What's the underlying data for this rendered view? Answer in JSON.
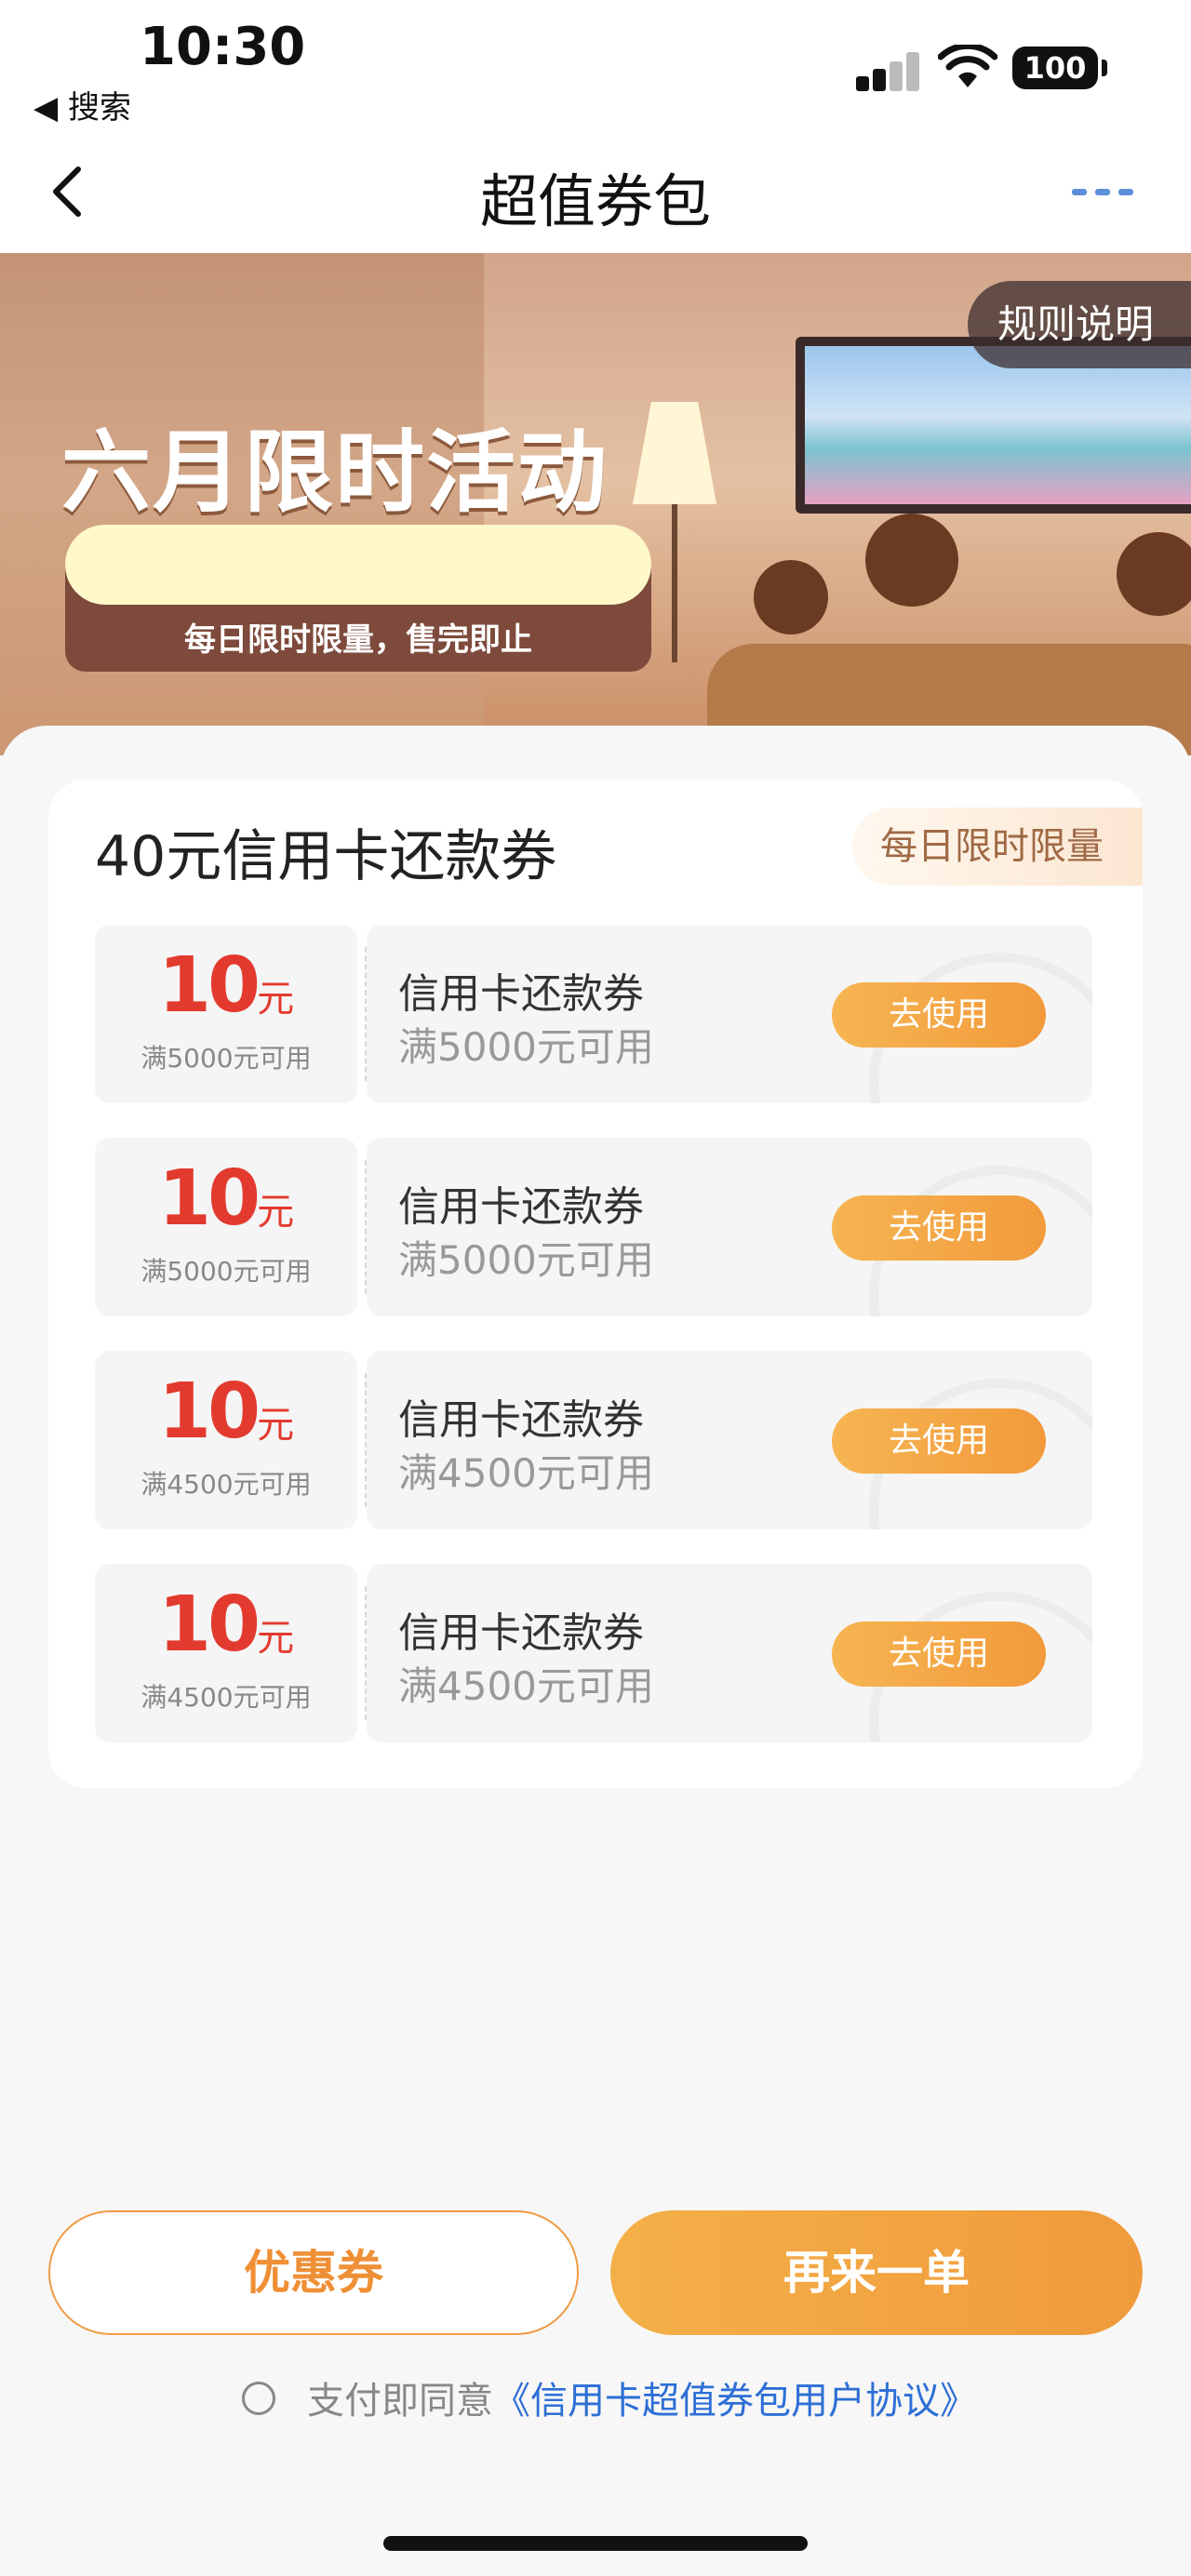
{
  "status_bar": {
    "time": "10:30",
    "back_app": "◀ 搜索",
    "battery": "100"
  },
  "nav": {
    "title": "超值券包"
  },
  "banner": {
    "title": "六月限时活动",
    "subtitle": "每日限时限量，售完即止",
    "rules_label": "规则说明"
  },
  "section": {
    "title": "40元信用卡还款券",
    "limit_tag": "每日限时限量"
  },
  "coupons": [
    {
      "amount": "10",
      "unit": "元",
      "condition_small": "满5000元可用",
      "name": "信用卡还款券",
      "condition": "满5000元可用",
      "action": "去使用"
    },
    {
      "amount": "10",
      "unit": "元",
      "condition_small": "满5000元可用",
      "name": "信用卡还款券",
      "condition": "满5000元可用",
      "action": "去使用"
    },
    {
      "amount": "10",
      "unit": "元",
      "condition_small": "满4500元可用",
      "name": "信用卡还款券",
      "condition": "满4500元可用",
      "action": "去使用"
    },
    {
      "amount": "10",
      "unit": "元",
      "condition_small": "满4500元可用",
      "name": "信用卡还款券",
      "condition": "满4500元可用",
      "action": "去使用"
    }
  ],
  "actions": {
    "coupon_label": "优惠券",
    "again_label": "再来一单"
  },
  "agreement": {
    "prefix": "支付即同意",
    "link": "《信用卡超值券包用户协议》"
  },
  "colors": {
    "accent": "#f09a3b",
    "amount_red": "#e33a2f",
    "link_blue": "#2d6fd6"
  }
}
